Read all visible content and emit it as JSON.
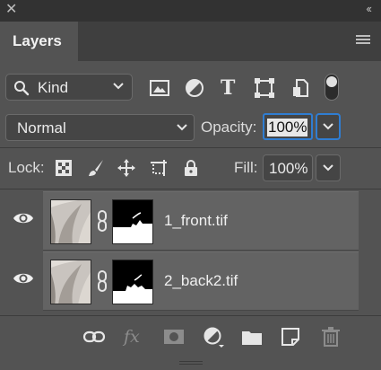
{
  "titlebar": {
    "close_glyph": "✕",
    "collapse_glyph": "‹‹"
  },
  "panel": {
    "tab_label": "Layers",
    "menu_icon": "hamburger-menu-icon"
  },
  "filter": {
    "kind_label": "Kind",
    "icons": [
      "pixel-layer-filter-icon",
      "adjustment-layer-filter-icon",
      "type-layer-filter-icon",
      "shape-layer-filter-icon",
      "smart-object-filter-icon"
    ],
    "type_glyph": "T"
  },
  "blend": {
    "mode": "Normal",
    "opacity_label": "Opacity:",
    "opacity_value": "100%"
  },
  "lock": {
    "label": "Lock:",
    "icons": [
      "lock-transparent-pixels-icon",
      "lock-image-pixels-icon",
      "lock-position-icon",
      "prevent-auto-nesting-icon",
      "lock-all-icon"
    ],
    "fill_label": "Fill:",
    "fill_value": "100%"
  },
  "layers": [
    {
      "name": "1_front.tif",
      "visible": true
    },
    {
      "name": "2_back2.tif",
      "visible": true
    }
  ],
  "footer": {
    "icons": [
      "link-layers-icon",
      "add-layer-style-icon",
      "add-mask-icon",
      "new-adjustment-layer-icon",
      "new-group-icon",
      "new-layer-icon",
      "delete-layer-icon"
    ],
    "fx_glyph": "fx"
  },
  "colors": {
    "panel_bg": "#535353",
    "accent": "#2f7dd2"
  }
}
